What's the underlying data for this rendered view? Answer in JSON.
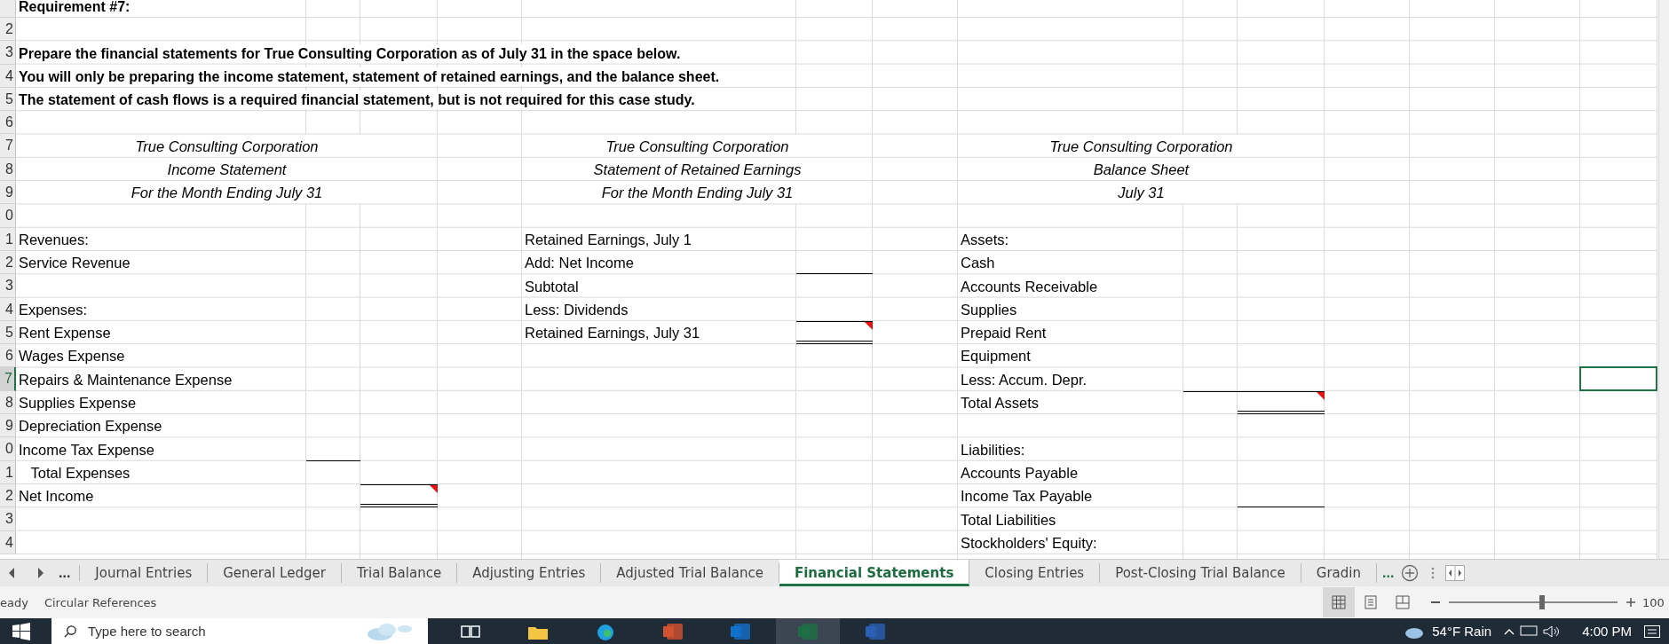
{
  "sheet": {
    "rows": [
      {
        "selected": false,
        "requirement": "Requirement #7:"
      },
      {
        "number": "2",
        "selected": false
      },
      {
        "number": "3",
        "selected": false,
        "instruction": "Prepare the financial statements for True Consulting Corporation as of July 31 in the space below."
      },
      {
        "number": "4",
        "selected": false,
        "instruction": "You will only be preparing the income statement, statement of retained earnings, and the balance sheet."
      },
      {
        "number": "5",
        "selected": false,
        "instruction": "The statement of cash flows is a required financial statement, but is not required for this case study."
      },
      {
        "number": "6",
        "selected": false
      },
      {
        "number": "7",
        "selected": false,
        "income": {
          "heading": "True Consulting Corporation"
        },
        "retained": {
          "heading": "True Consulting Corporation"
        },
        "balance": {
          "heading": "True Consulting Corporation"
        }
      },
      {
        "number": "8",
        "selected": false,
        "income": {
          "heading": "Income Statement"
        },
        "retained": {
          "heading": "Statement of Retained Earnings"
        },
        "balance": {
          "heading": "Balance Sheet"
        }
      },
      {
        "number": "9",
        "selected": false,
        "income": {
          "heading": "For the Month Ending July 31"
        },
        "retained": {
          "heading": "For the Month Ending July 31"
        },
        "balance": {
          "heading": "July 31"
        }
      },
      {
        "number": "0",
        "selected": false
      },
      {
        "number": "1",
        "selected": false,
        "income": {
          "label": "Revenues:"
        },
        "retained": {
          "label": "Retained Earnings, July 1"
        },
        "balance": {
          "label": "Assets:"
        }
      },
      {
        "number": "2",
        "selected": false,
        "income": {
          "label": "Service Revenue"
        },
        "retained": {
          "label": "Add: Net Income",
          "amount_1": {
            "underline": true
          }
        },
        "balance": {
          "label": "Cash"
        }
      },
      {
        "number": "3",
        "selected": false,
        "retained": {
          "label": "Subtotal"
        },
        "balance": {
          "label": "Accounts Receivable"
        }
      },
      {
        "number": "4",
        "selected": false,
        "income": {
          "label": "Expenses:"
        },
        "retained": {
          "label": "Less: Dividends"
        },
        "balance": {
          "label": "Supplies"
        }
      },
      {
        "number": "5",
        "selected": false,
        "income": {
          "label": "Rent Expense"
        },
        "retained": {
          "label": "Retained Earnings, July 31",
          "amount_1": {
            "overline": true,
            "double_underline": true,
            "comment": true
          }
        },
        "balance": {
          "label": "Prepaid Rent"
        }
      },
      {
        "number": "6",
        "selected": false,
        "income": {
          "label": "Wages Expense"
        },
        "balance": {
          "label": "Equipment"
        }
      },
      {
        "number": "7",
        "selected": true,
        "income": {
          "label": "Repairs & Maintenance Expense"
        },
        "balance": {
          "label": "Less: Accum. Depr."
        }
      },
      {
        "number": "8",
        "selected": false,
        "income": {
          "label": "Supplies Expense"
        },
        "balance": {
          "label": "Total Assets",
          "amount_1": {
            "overline": true
          },
          "amount_2": {
            "overline": true,
            "double_underline": true,
            "comment": true
          }
        }
      },
      {
        "number": "9",
        "selected": false,
        "income": {
          "label": "Depreciation Expense"
        }
      },
      {
        "number": "0",
        "selected": false,
        "income": {
          "label": "Income Tax Expense",
          "amount_1": {
            "underline": true
          }
        },
        "balance": {
          "label": "Liabilities:"
        }
      },
      {
        "number": "1",
        "selected": false,
        "income": {
          "label": "   Total Expenses"
        },
        "balance": {
          "label": "Accounts Payable"
        }
      },
      {
        "number": "2",
        "selected": false,
        "income": {
          "label": "Net Income",
          "amount_2": {
            "overline": true,
            "double_underline": true,
            "comment": true
          }
        },
        "balance": {
          "label": "Income Tax Payable",
          "amount_2": {
            "underline": true
          }
        }
      },
      {
        "number": "3",
        "selected": false,
        "balance": {
          "label": "Total Liabilities"
        }
      },
      {
        "number": "4",
        "selected": false,
        "balance": {
          "label": "Stockholders' Equity:"
        }
      }
    ]
  },
  "sheet_tabs": {
    "overflow_left": "...",
    "overflow_right": "...",
    "tabs": [
      {
        "label": "Journal Entries",
        "selected": false
      },
      {
        "label": "General Ledger",
        "selected": false
      },
      {
        "label": "Trial Balance",
        "selected": false
      },
      {
        "label": "Adjusting Entries",
        "selected": false
      },
      {
        "label": "Adjusted Trial Balance",
        "selected": false
      },
      {
        "label": "Financial Statements",
        "selected": true
      },
      {
        "label": "Closing Entries",
        "selected": false
      },
      {
        "label": "Post-Closing Trial Balance",
        "selected": false
      },
      {
        "label": "Gradin",
        "selected": false
      }
    ]
  },
  "status_bar": {
    "mode": "eady",
    "circular_references": "Circular References",
    "views": [
      {
        "kind": "normal",
        "selected": true
      },
      {
        "kind": "page-layout",
        "selected": false
      },
      {
        "kind": "page-break",
        "selected": false
      }
    ],
    "zoom": {
      "level": 0.55,
      "reading": "100"
    }
  },
  "taskbar": {
    "search": {
      "placeholder": "Type here to search"
    },
    "apps": [
      {
        "kind": "task-view",
        "active": false
      },
      {
        "kind": "folder",
        "active": false
      },
      {
        "kind": "browser",
        "active": false
      },
      {
        "kind": "slides",
        "active": false
      },
      {
        "kind": "mail",
        "active": false
      },
      {
        "kind": "spreadsheet",
        "active": true
      },
      {
        "kind": "document",
        "active": false
      }
    ],
    "weather": "54°F  Rain",
    "time": "4:00 PM"
  }
}
